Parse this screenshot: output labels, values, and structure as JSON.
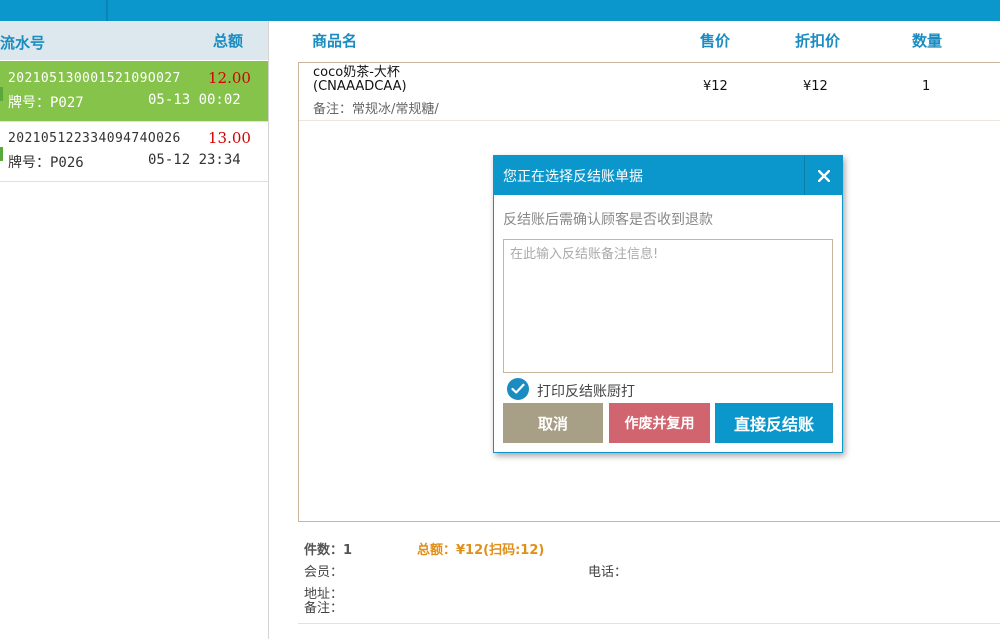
{
  "left_panel": {
    "col_serial": "流水号",
    "col_total": "总额",
    "orders": [
      {
        "serial": "20210513000152109O027",
        "amount": "12.00",
        "plate": "牌号：P027",
        "time": "05-13 00:02",
        "active": true
      },
      {
        "serial": "20210512233409474O026",
        "amount": "13.00",
        "plate": "牌号：P026",
        "time": "05-12 23:34",
        "active": false
      }
    ]
  },
  "items_table": {
    "headers": {
      "name": "商品名",
      "price": "售价",
      "discount": "折扣价",
      "qty": "数量"
    },
    "rows": [
      {
        "name": "coco奶茶-大杯\n(CNAAADCAA)",
        "note": "备注：常规冰/常规糖/",
        "price": "¥12",
        "discount": "¥12",
        "qty": "1"
      }
    ]
  },
  "footer": {
    "count": "件数：1",
    "total": "总额：¥12(扫码:12)",
    "member": "会员：",
    "phone": "电话：",
    "address": "地址：",
    "remark": "备注："
  },
  "dialog": {
    "title": "您正在选择反结账单据",
    "tip": "反结账后需确认顾客是否收到退款",
    "textarea_placeholder": "在此输入反结账备注信息!",
    "print_checkbox_label": "打印反结账厨打",
    "print_checked": true,
    "cancel_label": "取消",
    "void_reuse_label": "作废并复用",
    "direct_label": "直接反结账"
  },
  "colors": {
    "accent": "#0b97cb",
    "active_row": "#86c34a",
    "amount_red": "#d20000",
    "total_orange": "#e0901a",
    "cancel_btn": "#a89f87",
    "void_btn": "#d0646f"
  }
}
